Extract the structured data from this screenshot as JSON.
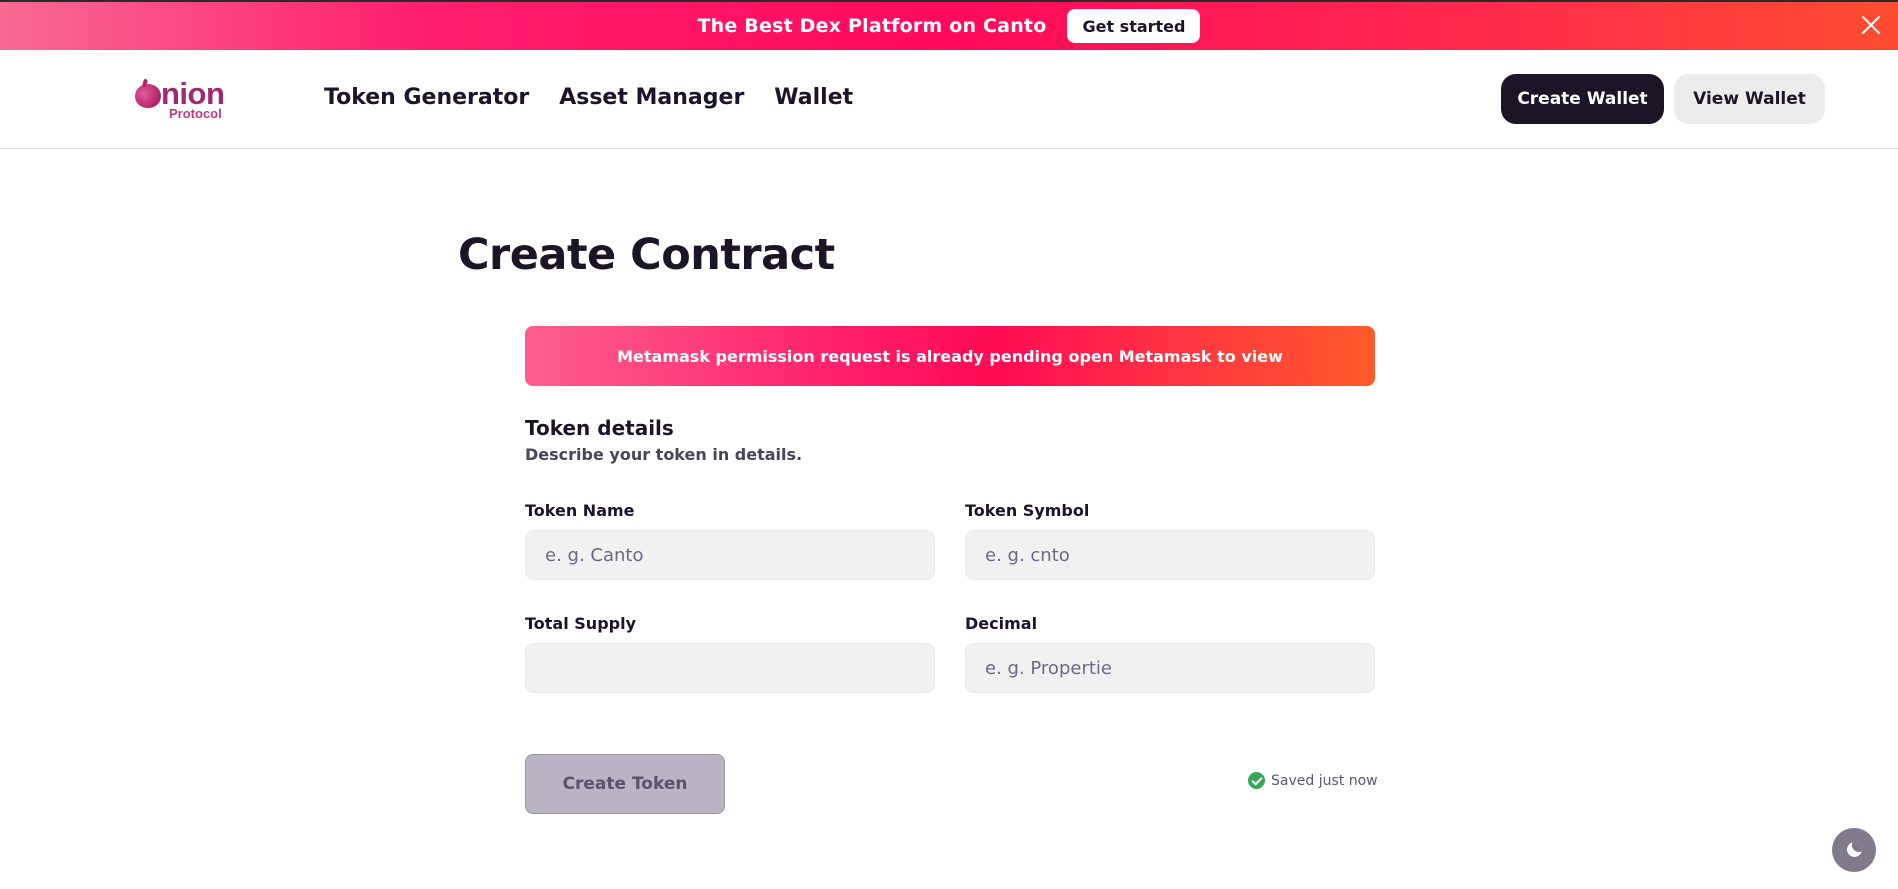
{
  "announcement": {
    "text": "The Best Dex Platform on Canto",
    "cta_label": "Get started"
  },
  "brand": {
    "word": "nion",
    "sub": "Protocol"
  },
  "nav": {
    "links": [
      "Token Generator",
      "Asset Manager",
      "Wallet"
    ],
    "create_wallet_label": "Create Wallet",
    "view_wallet_label": "View Wallet"
  },
  "main": {
    "title": "Create Contract",
    "alert_text": "Metamask permission request is already pending open Metamask to view",
    "section_title": "Token details",
    "section_desc": "Describe your token in details.",
    "fields": [
      {
        "label": "Token Name",
        "value": "",
        "placeholder": "e. g. Canto"
      },
      {
        "label": "Token Symbol",
        "value": "",
        "placeholder": "e. g. cnto"
      },
      {
        "label": "Total Supply",
        "value": "",
        "placeholder": ""
      },
      {
        "label": "Decimal",
        "value": "",
        "placeholder": "e. g. Propertie"
      }
    ],
    "submit_label": "Create Token",
    "saved_status": "Saved just now"
  },
  "icons": {
    "close": "close-icon",
    "logo": "onion-logo-icon",
    "saved": "check-circle-icon",
    "theme": "moon-icon"
  },
  "colors": {
    "banner_gradient": [
      "#f66a93",
      "#ff0a5c",
      "#ff4d30"
    ],
    "primary_dark": "#1c1528",
    "brand_magenta": "#a02a6d",
    "success": "#34a853",
    "disabled_button": "#b9b3c5"
  }
}
